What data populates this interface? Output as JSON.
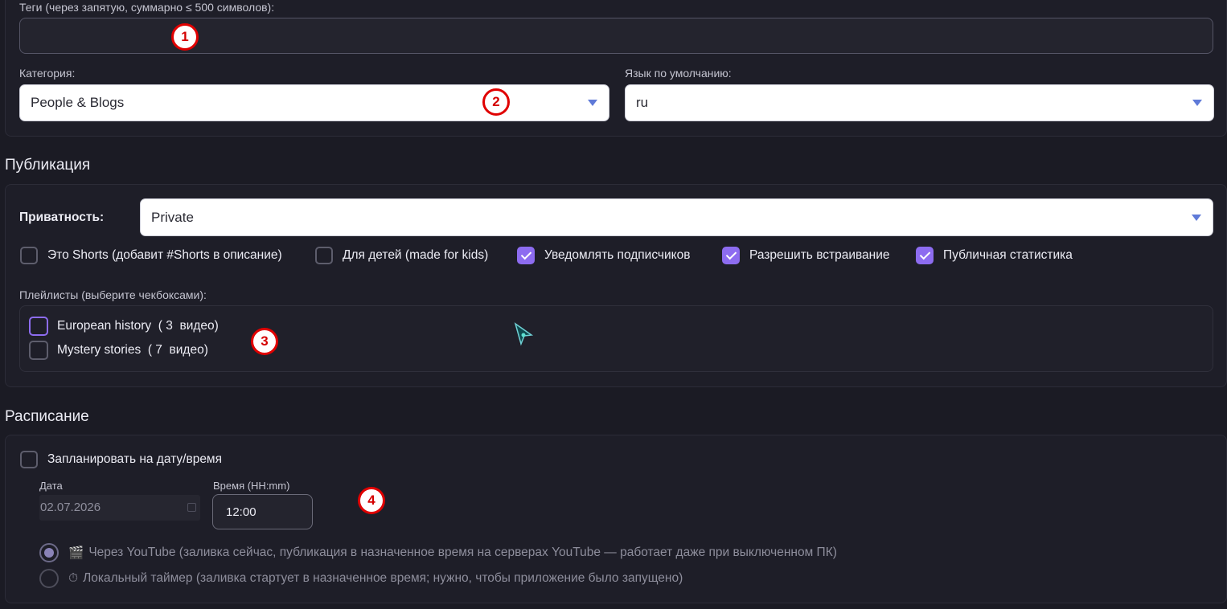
{
  "tags": {
    "label": "Теги (через запятую, суммарно ≤ 500 символов):",
    "value": ""
  },
  "category": {
    "label": "Категория:",
    "value": "People & Blogs"
  },
  "language": {
    "label": "Язык по умолчанию:",
    "value": "ru"
  },
  "publication": {
    "title": "Публикация",
    "privacy_label": "Приватность:",
    "privacy_value": "Private",
    "options": [
      {
        "label": "Это Shorts (добавит #Shorts в описание)",
        "checked": false
      },
      {
        "label": "Для детей (made for kids)",
        "checked": false
      },
      {
        "label": "Уведомлять подписчиков",
        "checked": true
      },
      {
        "label": "Разрешить встраивание",
        "checked": true
      },
      {
        "label": "Публичная статистика",
        "checked": true
      }
    ],
    "playlists_label": "Плейлисты (выберите чекбоксами):",
    "playlists": [
      {
        "label": "European history  ( 3  видео)",
        "checked": false
      },
      {
        "label": "Mystery stories  ( 7  видео)",
        "checked": false
      }
    ]
  },
  "schedule": {
    "title": "Расписание",
    "enable_label": "Запланировать на дату/время",
    "enabled": false,
    "date_label": "Дата",
    "date_value": "02.07.2026",
    "time_label": "Время (HH:mm)",
    "time_value": "12:00",
    "modes": [
      {
        "icon": "🎬",
        "label": "Через YouTube (заливка сейчас, публикация в назначенное время на серверах YouTube — работает даже при выключенном ПК)",
        "selected": true
      },
      {
        "icon": "⏱",
        "label": "Локальный таймер (заливка стартует в назначенное время; нужно, чтобы приложение было запущено)",
        "selected": false
      }
    ]
  },
  "markers": [
    "1",
    "2",
    "3",
    "4"
  ],
  "colors": {
    "accent": "#8d6cf0",
    "marker_red": "#e00000",
    "caret_blue": "#5f7ad8"
  }
}
